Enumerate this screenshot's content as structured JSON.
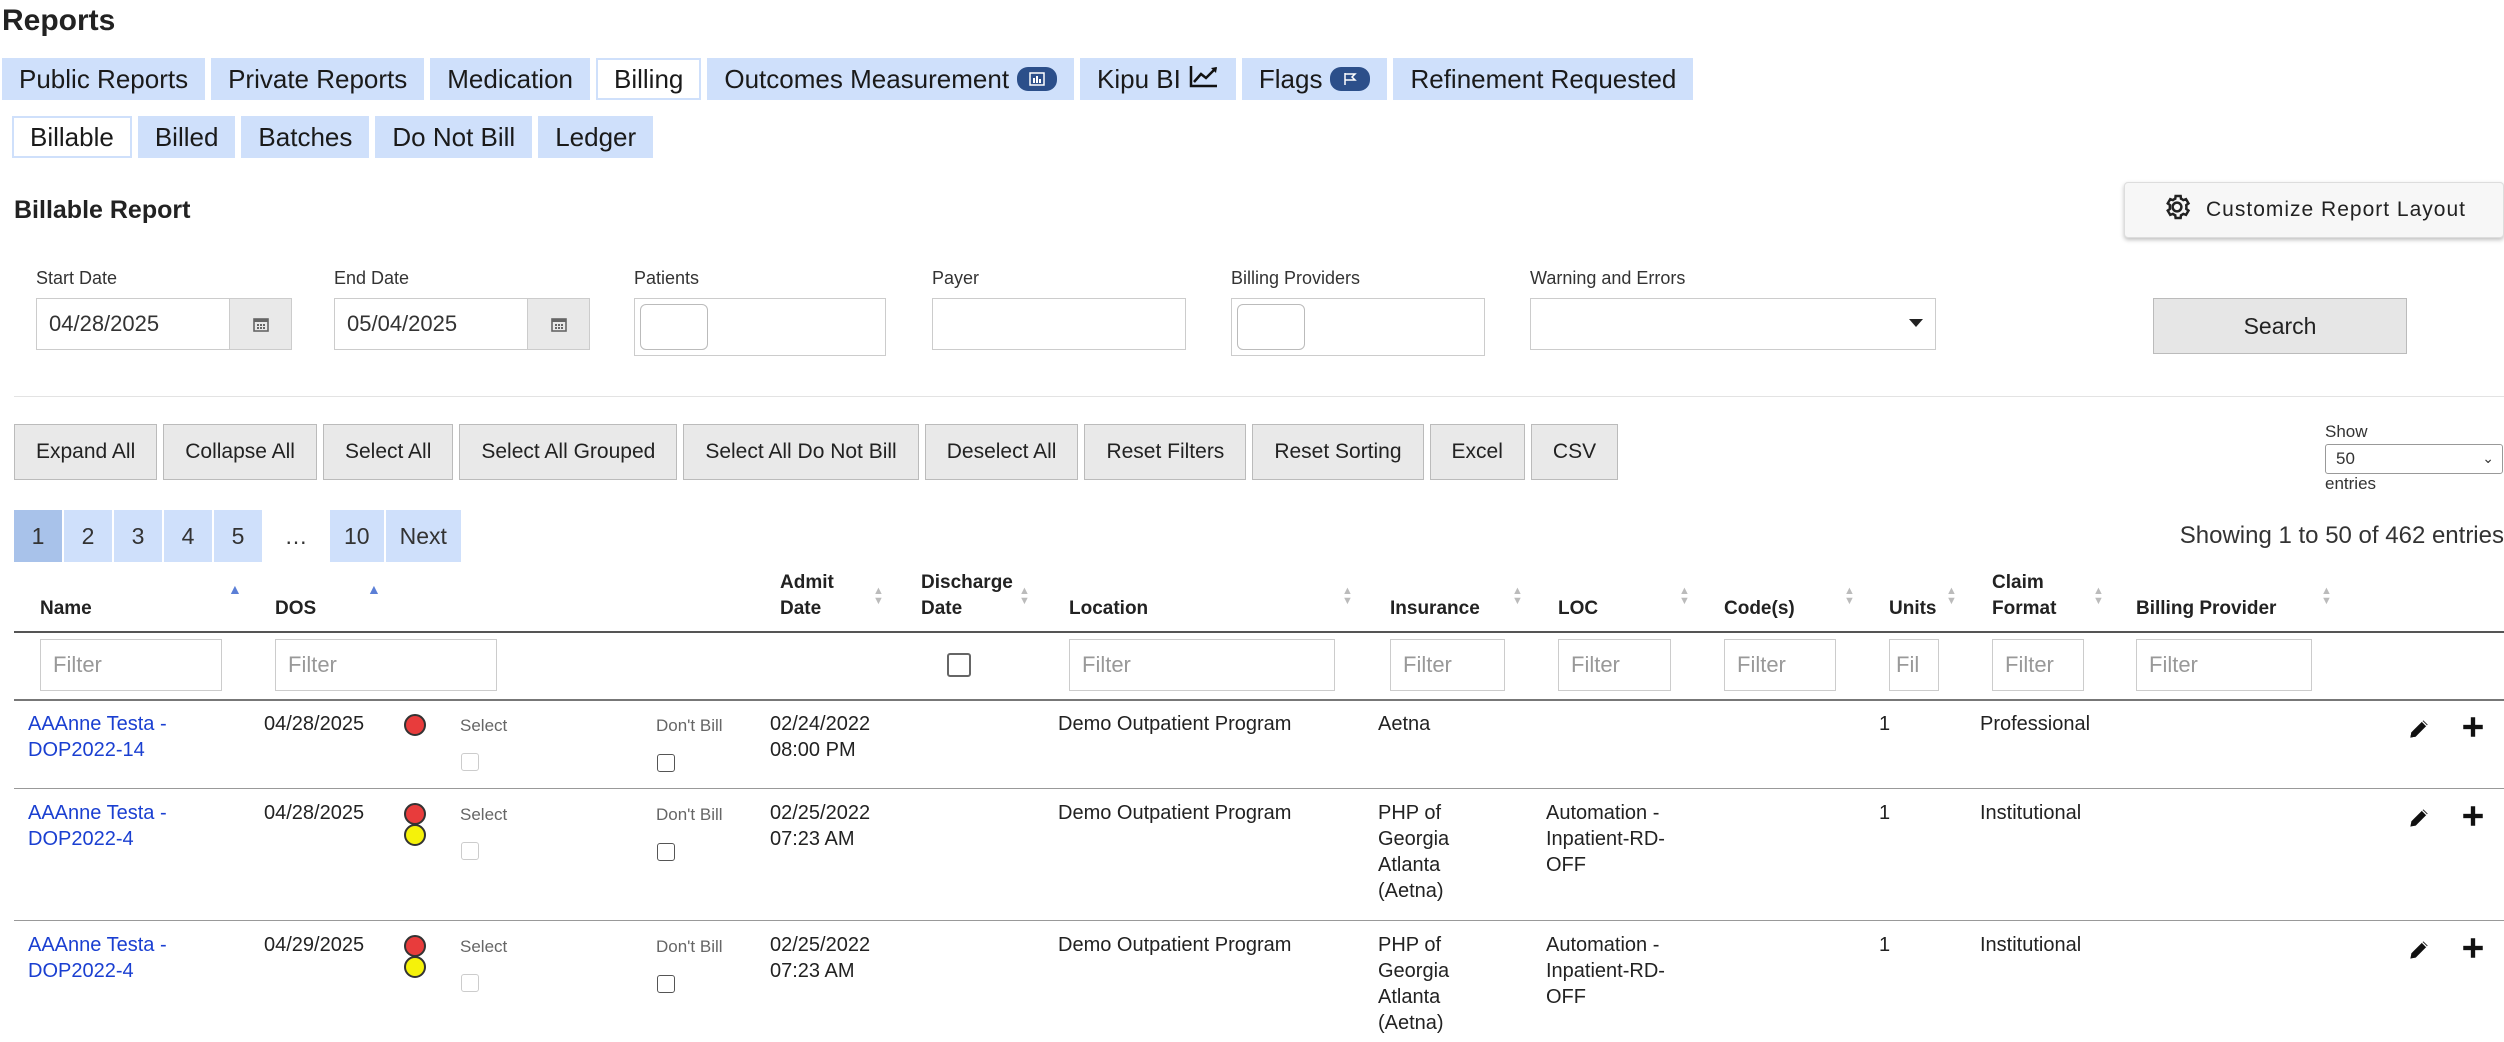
{
  "page_title": "Reports",
  "main_tabs": [
    {
      "label": "Public Reports"
    },
    {
      "label": "Private Reports"
    },
    {
      "label": "Medication"
    },
    {
      "label": "Billing"
    },
    {
      "label": "Outcomes Measurement",
      "icon": "bar-chart-icon"
    },
    {
      "label": "Kipu BI",
      "icon": "line-chart-icon"
    },
    {
      "label": "Flags",
      "icon": "flag-icon"
    },
    {
      "label": "Refinement Requested"
    }
  ],
  "sub_tabs": [
    {
      "label": "Billable"
    },
    {
      "label": "Billed"
    },
    {
      "label": "Batches"
    },
    {
      "label": "Do Not Bill"
    },
    {
      "label": "Ledger"
    }
  ],
  "section_title": "Billable Report",
  "customize_label": "Customize Report Layout",
  "filters": {
    "start_date_label": "Start Date",
    "start_date": "04/28/2025",
    "end_date_label": "End Date",
    "end_date": "05/04/2025",
    "patients_label": "Patients",
    "payer_label": "Payer",
    "billing_providers_label": "Billing Providers",
    "warnings_label": "Warning and Errors",
    "search_label": "Search"
  },
  "actions": [
    "Expand All",
    "Collapse All",
    "Select All",
    "Select All Grouped",
    "Select All Do Not Bill",
    "Deselect All",
    "Reset Filters",
    "Reset Sorting",
    "Excel",
    "CSV"
  ],
  "show_entries": {
    "show": "Show",
    "value": "50",
    "entries": "entries"
  },
  "pagination": {
    "pages": [
      "1",
      "2",
      "3",
      "4",
      "5"
    ],
    "ellipsis": "…",
    "last": "10",
    "next": "Next"
  },
  "showing_text": "Showing 1 to 50 of 462 entries",
  "columns": {
    "name": "Name",
    "dos": "DOS",
    "admit_1": "Admit",
    "admit_2": "Date",
    "discharge_1": "Discharge",
    "discharge_2": "Date",
    "location": "Location",
    "insurance": "Insurance",
    "loc": "LOC",
    "codes": "Code(s)",
    "units": "Units",
    "claim_1": "Claim",
    "claim_2": "Format",
    "billing_provider": "Billing Provider"
  },
  "filter_placeholders": {
    "full": "Filter",
    "short": "Fil"
  },
  "row_labels": {
    "select": "Select",
    "dont_bill": "Don't Bill"
  },
  "rows": [
    {
      "name_1": "AAAnne Testa -",
      "name_2": "DOP2022-14",
      "dos": "04/28/2025",
      "admit_1": "02/24/2022",
      "admit_2": "08:00 PM",
      "location": "Demo Outpatient Program",
      "ins_1": "Aetna",
      "ins_2": "",
      "ins_3": "",
      "ins_4": "",
      "loc_1": "",
      "loc_2": "",
      "loc_3": "",
      "units": "1",
      "claim": "Professional"
    },
    {
      "name_1": "AAAnne Testa -",
      "name_2": "DOP2022-4",
      "dos": "04/28/2025",
      "admit_1": "02/25/2022",
      "admit_2": "07:23 AM",
      "location": "Demo Outpatient Program",
      "ins_1": "PHP of",
      "ins_2": "Georgia",
      "ins_3": "Atlanta",
      "ins_4": "(Aetna)",
      "loc_1": "Automation -",
      "loc_2": "Inpatient-RD-",
      "loc_3": "OFF",
      "units": "1",
      "claim": "Institutional"
    },
    {
      "name_1": "AAAnne Testa -",
      "name_2": "DOP2022-4",
      "dos": "04/29/2025",
      "admit_1": "02/25/2022",
      "admit_2": "07:23 AM",
      "location": "Demo Outpatient Program",
      "ins_1": "PHP of",
      "ins_2": "Georgia",
      "ins_3": "Atlanta",
      "ins_4": "(Aetna)",
      "loc_1": "Automation -",
      "loc_2": "Inpatient-RD-",
      "loc_3": "OFF",
      "units": "1",
      "claim": "Institutional"
    }
  ]
}
